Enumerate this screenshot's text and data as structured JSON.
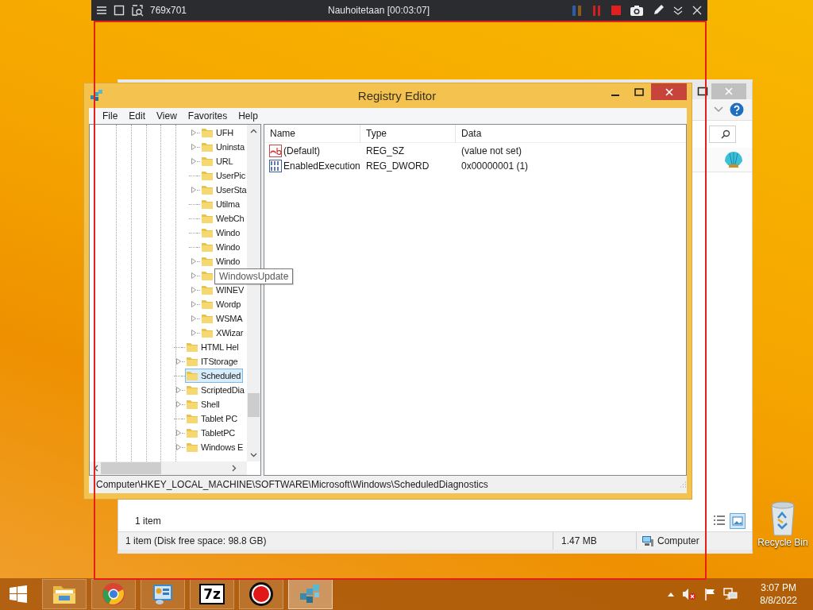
{
  "recorder_bar": {
    "size": "769x701",
    "status": "Nauhoitetaan [00:03:07]"
  },
  "explorer_window": {
    "item_count": "1 item",
    "status_bar": [
      "1 item (Disk free space: 98.8 GB)",
      "1.47 MB",
      "Computer"
    ]
  },
  "registry_editor": {
    "title": "Registry Editor",
    "menu": [
      "File",
      "Edit",
      "View",
      "Favorites",
      "Help"
    ],
    "tree": {
      "items": [
        {
          "children": [
            {
              "label": "UFH",
              "expandable": true,
              "selected": false
            },
            {
              "label": "Uninsta",
              "expandable": true,
              "selected": false
            },
            {
              "label": "URL",
              "expandable": true,
              "selected": false
            },
            {
              "label": "UserPic",
              "expandable": false,
              "selected": false
            },
            {
              "label": "UserSta",
              "expandable": true,
              "selected": false
            },
            {
              "label": "Utilma",
              "expandable": false,
              "selected": false
            },
            {
              "label": "WebCh",
              "expandable": false,
              "selected": false
            },
            {
              "label": "Windo",
              "expandable": false,
              "selected": false
            },
            {
              "label": "Windo",
              "expandable": false,
              "selected": false
            },
            {
              "label": "Windo",
              "expandable": true,
              "selected": false
            },
            {
              "tooltip": "WindowsUpdate",
              "expandable": true,
              "selected": false
            },
            {
              "label": "WINEV",
              "expandable": true,
              "selected": false
            },
            {
              "label": "Wordp",
              "expandable": true,
              "selected": false
            },
            {
              "label": "WSMA",
              "expandable": true,
              "selected": false
            },
            {
              "label": "XWizar",
              "expandable": true,
              "selected": false
            }
          ]
        },
        {
          "label": "HTML Hel",
          "expandable": false,
          "selected": false
        },
        {
          "label": "ITStorage",
          "expandable": true,
          "selected": false
        },
        {
          "label": "Scheduled",
          "expandable": false,
          "selected": true
        },
        {
          "label": "ScriptedDia",
          "expandable": true,
          "selected": false
        },
        {
          "label": "Shell",
          "expandable": true,
          "selected": false
        },
        {
          "label": "Tablet PC",
          "expandable": false,
          "selected": false
        },
        {
          "label": "TabletPC",
          "expandable": true,
          "selected": false
        },
        {
          "label": "Windows E",
          "expandable": true,
          "selected": false
        }
      ]
    },
    "values": {
      "columns": [
        "Name",
        "Type",
        "Data"
      ],
      "rows": [
        {
          "kind": "string",
          "name": "(Default)",
          "type": "REG_SZ",
          "data": "(value not set)"
        },
        {
          "kind": "dword",
          "name": "EnabledExecution",
          "type": "REG_DWORD",
          "data": "0x00000001 (1)"
        }
      ]
    },
    "status_bar": "Computer\\HKEY_LOCAL_MACHINE\\SOFTWARE\\Microsoft\\Windows\\ScheduledDiagnostics"
  },
  "desktop_icons": [
    {
      "label": "Recycle Bin"
    }
  ],
  "taskbar": {
    "apps": [
      {
        "kind": "files",
        "selected": false
      },
      {
        "kind": "browser",
        "selected": false
      },
      {
        "kind": "panel",
        "selected": false
      },
      {
        "kind": "archiver",
        "label": "7z",
        "selected": false
      },
      {
        "kind": "record",
        "selected": false
      },
      {
        "kind": "registry",
        "selected": true
      }
    ],
    "clock": {
      "time": "3:07 PM",
      "date": "8/8/2022"
    }
  }
}
